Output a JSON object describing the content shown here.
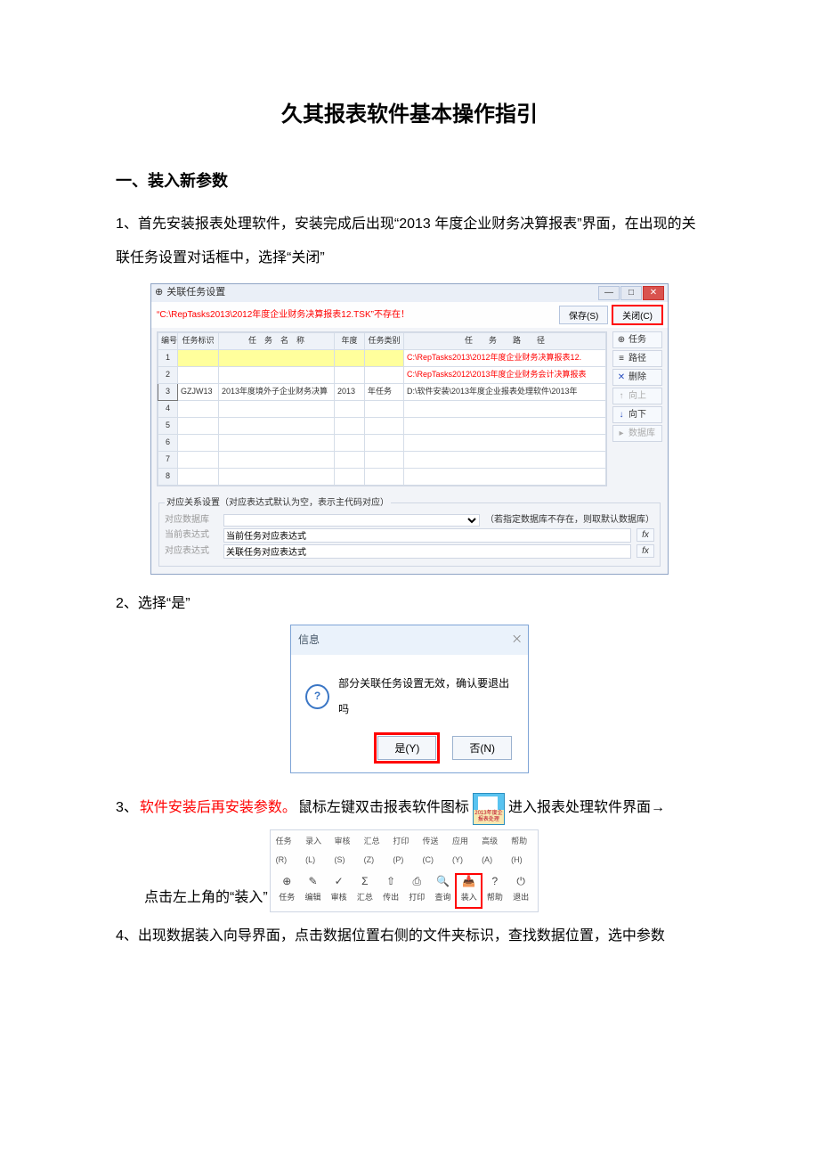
{
  "document": {
    "title": "久其报表软件基本操作指引",
    "section1": "一、装入新参数",
    "p1": "1、首先安装报表处理软件，安装完成后出现“2013 年度企业财务决算报表”界面，在出现的关联任务设置对话框中，选择“关闭”",
    "p2": "2、选择“是”",
    "p3a": "3、",
    "p3b_red": "软件安装后再安装参数。",
    "p3c": "鼠标左键双击报表软件图标",
    "p3d": "进入报表处理软件界面→",
    "p3e": "点击左上角的“装入”",
    "p4": "4、出现数据装入向导界面，点击数据位置右侧的文件夹标识，查找数据位置，选中参数"
  },
  "dialog1": {
    "appicon": "⊕",
    "title": "关联任务设置",
    "warning": "“C:\\RepTasks2013\\2012年度企业财务决算报表12.TSK”不存在！",
    "save_btn": "保存(S)",
    "close_btn": "关闭(C)",
    "win_min": "—",
    "win_max": "□",
    "win_close": "✕",
    "headers": {
      "no": "编号",
      "mark": "任务标识",
      "name": "任　务　名　称",
      "year": "年度",
      "type": "任务类别",
      "path": "任　　务　　路　　径"
    },
    "rows": {
      "r1_path": "C:\\RepTasks2013\\2012年度企业财务决算报表12.",
      "r2_path": "C:\\RepTasks2012\\2013年度企业财务会计决算报表",
      "r3_mark": "GZJW13",
      "r3_name": "2013年度境外子企业财务决算",
      "r3_year": "2013",
      "r3_type": "年任务",
      "r3_path": "D:\\软件安装\\2013年度企业报表处理软件\\2013年",
      "n1": "1",
      "n2": "2",
      "n3": "3",
      "n4": "4",
      "n5": "5",
      "n6": "6",
      "n7": "7",
      "n8": "8"
    },
    "side": {
      "task": "任务",
      "path": "路径",
      "del": "删除",
      "up": "向上",
      "down": "向下",
      "db": "数据库",
      "icon_task": "⊕",
      "icon_path": "≡",
      "icon_del": "✕",
      "icon_up": "↑",
      "icon_down": "↓",
      "icon_db": "▸"
    },
    "bottom": {
      "legend": "对应关系设置（对应表达式默认为空，表示主代码对应）",
      "lbl_db": "对应数据库",
      "db_hint": "（若指定数据库不存在，则取默认数据库）",
      "lbl_cur": "当前表达式",
      "val_cur": "当前任务对应表达式",
      "lbl_rel": "对应表达式",
      "val_rel": "关联任务对应表达式",
      "fx": "fx"
    }
  },
  "dialog2": {
    "title": "信息",
    "close_glyph": "⨉",
    "question": "?",
    "msg": "部分关联任务设置无效，确认要退出吗",
    "yes": "是(Y)",
    "no": "否(N)"
  },
  "appicon": {
    "caption": "2013年度企\n报表处理"
  },
  "toolbar": {
    "menu": {
      "m1": "任务(R)",
      "m2": "录入(L)",
      "m3": "审核(S)",
      "m4": "汇总(Z)",
      "m5": "打印(P)",
      "m6": "传送(C)",
      "m7": "应用(Y)",
      "m8": "高级(A)",
      "m9": "帮助(H)"
    },
    "items": {
      "task": {
        "ic": "⊕",
        "lbl": "任务"
      },
      "edit": {
        "ic": "✎",
        "lbl": "编辑"
      },
      "audit": {
        "ic": "✓",
        "lbl": "审核"
      },
      "sum": {
        "ic": "Σ",
        "lbl": "汇总"
      },
      "send": {
        "ic": "⇧",
        "lbl": "传出"
      },
      "print": {
        "ic": "⎙",
        "lbl": "打印"
      },
      "query": {
        "ic": "🔍",
        "lbl": "查询"
      },
      "load": {
        "ic": "📥",
        "lbl": "装入"
      },
      "help": {
        "ic": "?",
        "lbl": "帮助"
      },
      "exit": {
        "ic": "⏻",
        "lbl": "退出"
      }
    }
  }
}
